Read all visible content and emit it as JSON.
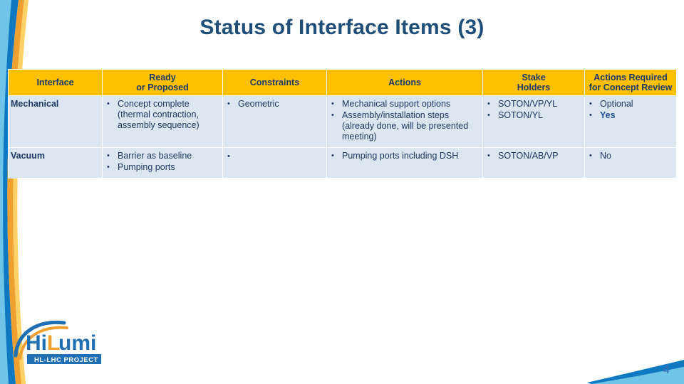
{
  "slide": {
    "title": "Status of Interface Items (3)",
    "page_number": "4"
  },
  "colors": {
    "title": "#1F4E79",
    "header_bg": "#FFC000",
    "cell_bg": "#DCE6F1",
    "text": "#1F3864",
    "accent_blue": "#0070C0",
    "logo_blue": "#1F6FB5",
    "logo_orange": "#F0A030"
  },
  "table": {
    "headers": [
      "Interface",
      "Ready\nor Proposed",
      "Constraints",
      "Actions",
      "Stake\nHolders",
      "Actions Required\nfor Concept Review"
    ],
    "headers_lines": {
      "h0": "Interface",
      "h1a": "Ready",
      "h1b": "or Proposed",
      "h2": "Constraints",
      "h3": "Actions",
      "h4a": "Stake",
      "h4b": "Holders",
      "h5a": "Actions Required",
      "h5b": "for Concept Review"
    },
    "rows": [
      {
        "interface": "Mechanical",
        "ready": [
          "Concept complete (thermal contraction, assembly sequence)"
        ],
        "constraints": [
          "Geometric"
        ],
        "actions": [
          "Mechanical support options",
          "Assembly/installation steps (already done, will be presented meeting)"
        ],
        "stakeholders": [
          "SOTON/VP/YL",
          "SOTON/YL"
        ],
        "required": [
          "Optional",
          "Yes"
        ],
        "required_emphasis": [
          false,
          true
        ]
      },
      {
        "interface": "Vacuum",
        "ready": [
          "Barrier as baseline",
          "Pumping ports"
        ],
        "constraints": [
          ""
        ],
        "actions": [
          "Pumping ports including DSH"
        ],
        "stakeholders": [
          "SOTON/AB/VP"
        ],
        "required": [
          "No"
        ],
        "required_emphasis": [
          false
        ]
      }
    ]
  },
  "logo": {
    "primary": "HiLumi",
    "sub": "HL-LHC PROJECT"
  }
}
